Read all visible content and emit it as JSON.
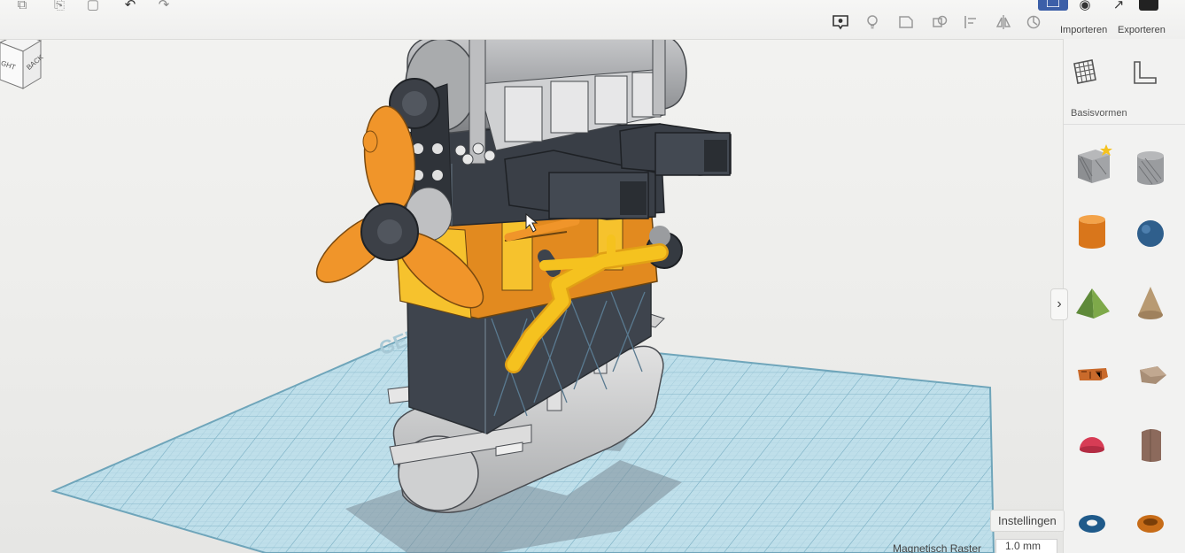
{
  "toolbar": {
    "importeren": "Importeren",
    "exporteren": "Exporteren"
  },
  "viewcube": {
    "left_face": "GHT",
    "right_face": "BACK"
  },
  "workplane": {
    "watermark": "GEL"
  },
  "panel": {
    "category_label": "Basisvormen",
    "shapes": [
      {
        "name": "box-hole-shape"
      },
      {
        "name": "cylinder-hole-shape"
      },
      {
        "name": "cylinder-shape"
      },
      {
        "name": "sphere-shape"
      },
      {
        "name": "pyramid-shape"
      },
      {
        "name": "cone-shape"
      },
      {
        "name": "text-shape"
      },
      {
        "name": "polygon-shape"
      },
      {
        "name": "half-sphere-shape"
      },
      {
        "name": "round-roof-shape"
      },
      {
        "name": "torus-shape"
      },
      {
        "name": "tube-shape"
      }
    ]
  },
  "settings": {
    "button_label": "Instellingen",
    "grid_label": "Magnetisch Raster",
    "grid_value": "1.0 mm"
  },
  "colors": {
    "orange": "#f0952a",
    "yellow": "#f5c21f",
    "dark": "#3d434c",
    "grey": "#9a9c9f",
    "workplane": "#bcdde8"
  }
}
